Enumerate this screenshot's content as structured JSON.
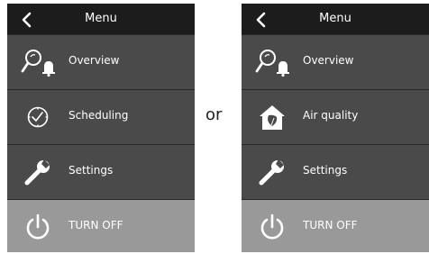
{
  "separator": "or",
  "left_menu": {
    "title": "Menu",
    "items": [
      {
        "label": "Overview",
        "icon": "overview-icon"
      },
      {
        "label": "Scheduling",
        "icon": "clock-icon"
      },
      {
        "label": "Settings",
        "icon": "wrench-icon"
      }
    ],
    "turn_off_label": "TURN OFF"
  },
  "right_menu": {
    "title": "Menu",
    "items": [
      {
        "label": "Overview",
        "icon": "overview-icon"
      },
      {
        "label": "Air quality",
        "icon": "air-quality-icon"
      },
      {
        "label": "Settings",
        "icon": "wrench-icon"
      }
    ],
    "turn_off_label": "TURN OFF"
  },
  "colors": {
    "header": "#1c1c1c",
    "item": "#4a4a4a",
    "divider": "#2a2a2a",
    "turn_off": "#999999",
    "text": "#ffffff"
  }
}
